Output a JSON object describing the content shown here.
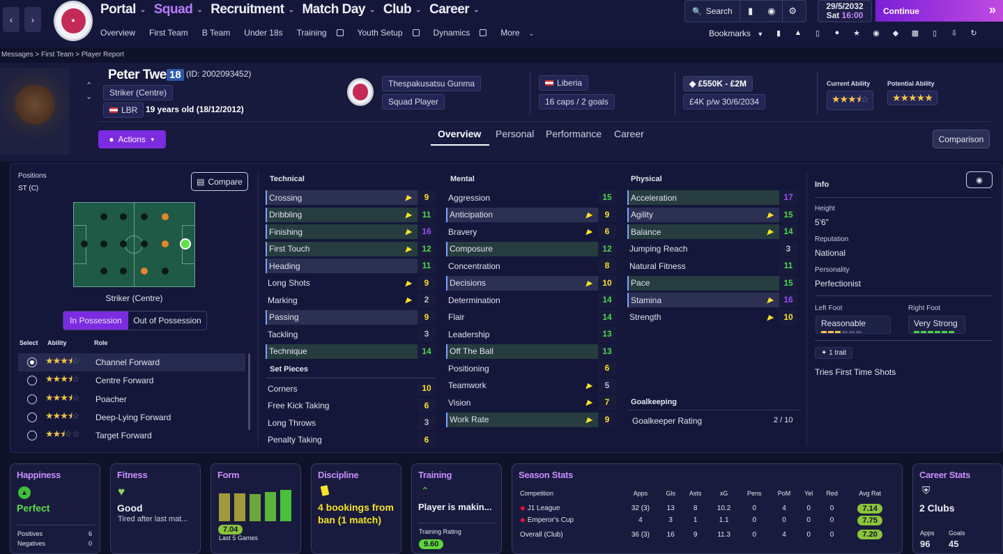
{
  "nav": {
    "main": [
      {
        "label": "Portal",
        "chevron": true
      },
      {
        "label": "Squad",
        "chevron": true,
        "active": true
      },
      {
        "label": "Recruitment",
        "chevron": true
      },
      {
        "label": "Match Day",
        "chevron": true
      },
      {
        "label": "Club",
        "chevron": true
      },
      {
        "label": "Career",
        "chevron": true
      }
    ],
    "sub": [
      "Overview",
      "First Team",
      "B Team",
      "Under 18s",
      "Training",
      "Youth Setup",
      "Dynamics",
      "More"
    ],
    "search_label": "Search",
    "date": "29/5/2032",
    "day": "Sat",
    "time": "16:00",
    "continue_label": "Continue",
    "bookmarks_label": "Bookmarks"
  },
  "breadcrumb": [
    "Messages",
    "First Team",
    "Player Report"
  ],
  "player": {
    "name": "Peter Tweh",
    "number": "18",
    "id": "(ID: 2002093452)",
    "position": "Striker (Centre)",
    "nationality_code": "LBR",
    "age": "19 years old (18/12/2012)",
    "club": "Thespakusatsu Gunma",
    "squad_status": "Squad Player",
    "country": "Liberia",
    "caps": "16 caps / 2 goals",
    "value": "£550K - £2M",
    "wage": "£4K p/w 30/6/2034",
    "current_ability_label": "Current Ability",
    "potential_ability_label": "Potential Ability",
    "current_ability_stars": 3.5,
    "potential_ability_stars": 5
  },
  "actions_label": "Actions",
  "tabs": [
    "Overview",
    "Personal",
    "Performance",
    "Career"
  ],
  "comparison_label": "Comparison",
  "positions": {
    "label": "Positions",
    "value": "ST (C)",
    "compare_label": "Compare",
    "role_caption": "Striker (Centre)",
    "in_possession": "In Possession",
    "out_possession": "Out of Possession",
    "col_select": "Select",
    "col_ability": "Ability",
    "col_role": "Role",
    "roles": [
      {
        "name": "Channel Forward",
        "stars": 3.5,
        "selected": true
      },
      {
        "name": "Centre Forward",
        "stars": 3.5,
        "selected": false
      },
      {
        "name": "Poacher",
        "stars": 3.5,
        "selected": false
      },
      {
        "name": "Deep-Lying Forward",
        "stars": 3.5,
        "selected": false
      },
      {
        "name": "Target Forward",
        "stars": 2.5,
        "selected": false
      }
    ]
  },
  "technical": {
    "title": "Technical",
    "attrs": [
      {
        "n": "Crossing",
        "v": "9",
        "c": "y",
        "ic": true,
        "bg": "hl",
        "edge": true
      },
      {
        "n": "Dribbling",
        "v": "11",
        "c": "gr",
        "ic": true,
        "bg": "g",
        "edge": true
      },
      {
        "n": "Finishing",
        "v": "16",
        "c": "p",
        "ic": true,
        "bg": "g",
        "edge": true
      },
      {
        "n": "First Touch",
        "v": "12",
        "c": "gr",
        "ic": true,
        "bg": "g",
        "edge": true
      },
      {
        "n": "Heading",
        "v": "11",
        "c": "gr",
        "ic": false,
        "bg": "hl",
        "edge": true
      },
      {
        "n": "Long Shots",
        "v": "9",
        "c": "y",
        "ic": true,
        "bg": "",
        "edge": false
      },
      {
        "n": "Marking",
        "v": "2",
        "c": "w",
        "ic": true,
        "bg": "",
        "edge": false
      },
      {
        "n": "Passing",
        "v": "9",
        "c": "y",
        "ic": false,
        "bg": "hl",
        "edge": true
      },
      {
        "n": "Tackling",
        "v": "3",
        "c": "w",
        "ic": false,
        "bg": "",
        "edge": false
      },
      {
        "n": "Technique",
        "v": "14",
        "c": "gr",
        "ic": false,
        "bg": "g",
        "edge": true
      }
    ]
  },
  "set_pieces": {
    "title": "Set Pieces",
    "attrs": [
      {
        "n": "Corners",
        "v": "10",
        "c": "y"
      },
      {
        "n": "Free Kick Taking",
        "v": "6",
        "c": "y"
      },
      {
        "n": "Long Throws",
        "v": "3",
        "c": "w"
      },
      {
        "n": "Penalty Taking",
        "v": "6",
        "c": "y"
      }
    ]
  },
  "mental": {
    "title": "Mental",
    "attrs": [
      {
        "n": "Aggression",
        "v": "15",
        "c": "gr",
        "ic": false,
        "bg": "",
        "edge": false
      },
      {
        "n": "Anticipation",
        "v": "9",
        "c": "y",
        "ic": true,
        "bg": "hl",
        "edge": true
      },
      {
        "n": "Bravery",
        "v": "6",
        "c": "y",
        "ic": true,
        "bg": "",
        "edge": false
      },
      {
        "n": "Composure",
        "v": "12",
        "c": "gr",
        "ic": false,
        "bg": "g",
        "edge": true
      },
      {
        "n": "Concentration",
        "v": "8",
        "c": "y",
        "ic": false,
        "bg": "",
        "edge": false
      },
      {
        "n": "Decisions",
        "v": "10",
        "c": "y",
        "ic": true,
        "bg": "hl",
        "edge": true
      },
      {
        "n": "Determination",
        "v": "14",
        "c": "gr",
        "ic": false,
        "bg": "",
        "edge": false
      },
      {
        "n": "Flair",
        "v": "14",
        "c": "gr",
        "ic": false,
        "bg": "",
        "edge": false
      },
      {
        "n": "Leadership",
        "v": "13",
        "c": "gr",
        "ic": false,
        "bg": "",
        "edge": false
      },
      {
        "n": "Off The Ball",
        "v": "13",
        "c": "gr",
        "ic": false,
        "bg": "g",
        "edge": true
      },
      {
        "n": "Positioning",
        "v": "6",
        "c": "y",
        "ic": false,
        "bg": "",
        "edge": false
      },
      {
        "n": "Teamwork",
        "v": "5",
        "c": "w",
        "ic": true,
        "bg": "",
        "edge": false
      },
      {
        "n": "Vision",
        "v": "7",
        "c": "y",
        "ic": true,
        "bg": "",
        "edge": false
      },
      {
        "n": "Work Rate",
        "v": "9",
        "c": "y",
        "ic": true,
        "bg": "g",
        "edge": true
      }
    ]
  },
  "physical": {
    "title": "Physical",
    "attrs": [
      {
        "n": "Acceleration",
        "v": "17",
        "c": "p",
        "ic": false,
        "bg": "g",
        "edge": true
      },
      {
        "n": "Agility",
        "v": "15",
        "c": "gr",
        "ic": true,
        "bg": "hl",
        "edge": true
      },
      {
        "n": "Balance",
        "v": "14",
        "c": "gr",
        "ic": true,
        "bg": "g",
        "edge": true
      },
      {
        "n": "Jumping Reach",
        "v": "3",
        "c": "w",
        "ic": false,
        "bg": "",
        "edge": false
      },
      {
        "n": "Natural Fitness",
        "v": "11",
        "c": "gr",
        "ic": false,
        "bg": "",
        "edge": false
      },
      {
        "n": "Pace",
        "v": "15",
        "c": "gr",
        "ic": false,
        "bg": "g",
        "edge": true
      },
      {
        "n": "Stamina",
        "v": "16",
        "c": "p",
        "ic": true,
        "bg": "hl",
        "edge": true
      },
      {
        "n": "Strength",
        "v": "10",
        "c": "y",
        "ic": true,
        "bg": "",
        "edge": false
      }
    ]
  },
  "goalkeeping": {
    "title": "Goalkeeping",
    "label": "Goalkeeper Rating",
    "value": "2 / 10"
  },
  "info": {
    "title": "Info",
    "height_label": "Height",
    "height": "5'6\"",
    "reputation_label": "Reputation",
    "reputation": "National",
    "personality_label": "Personality",
    "personality": "Perfectionist",
    "left_foot_label": "Left Foot",
    "left_foot": "Reasonable",
    "right_foot_label": "Right Foot",
    "right_foot": "Very Strong",
    "trait_count": "1 trait",
    "trait": "Tries First Time Shots"
  },
  "cards": {
    "happiness": {
      "title": "Happiness",
      "value": "Perfect",
      "pos_label": "Positives",
      "pos": "6",
      "neg_label": "Negatives",
      "neg": "0"
    },
    "fitness": {
      "title": "Fitness",
      "value": "Good",
      "sub": "Tired after last mat..."
    },
    "form": {
      "title": "Form",
      "rating": "7.04",
      "sub": "Last 5 Games",
      "bars": [
        0.8,
        0.8,
        0.78,
        0.84,
        0.9
      ]
    },
    "discipline": {
      "title": "Discipline",
      "value": "4 bookings from ban (1 match)"
    },
    "training": {
      "title": "Training",
      "value": "Player is makin...",
      "rating_label": "Training Rating",
      "rating": "9.60"
    },
    "season": {
      "title": "Season Stats",
      "headers": [
        "Competition",
        "Apps",
        "Gls",
        "Asts",
        "xG",
        "Pens",
        "PoM",
        "Yel",
        "Red",
        "Avg Rat"
      ],
      "rows": [
        [
          "J1 League",
          "32 (3)",
          "13",
          "8",
          "10.2",
          "0",
          "4",
          "0",
          "0",
          "7.14"
        ],
        [
          "Emperor's Cup",
          "4",
          "3",
          "1",
          "1.1",
          "0",
          "0",
          "0",
          "0",
          "7.75"
        ],
        [
          "Overall (Club)",
          "36 (3)",
          "16",
          "9",
          "11.3",
          "0",
          "4",
          "0",
          "0",
          "7.20"
        ]
      ]
    },
    "career": {
      "title": "Career Stats",
      "value": "2 Clubs",
      "apps_label": "Apps",
      "apps": "96",
      "goals_label": "Goals",
      "goals": "45"
    }
  },
  "colors": {
    "accent": "#7b2be0",
    "good": "#4ed64a",
    "ok": "#f6e22a",
    "elite": "#9a4ff0",
    "card_title": "#c98cff"
  }
}
